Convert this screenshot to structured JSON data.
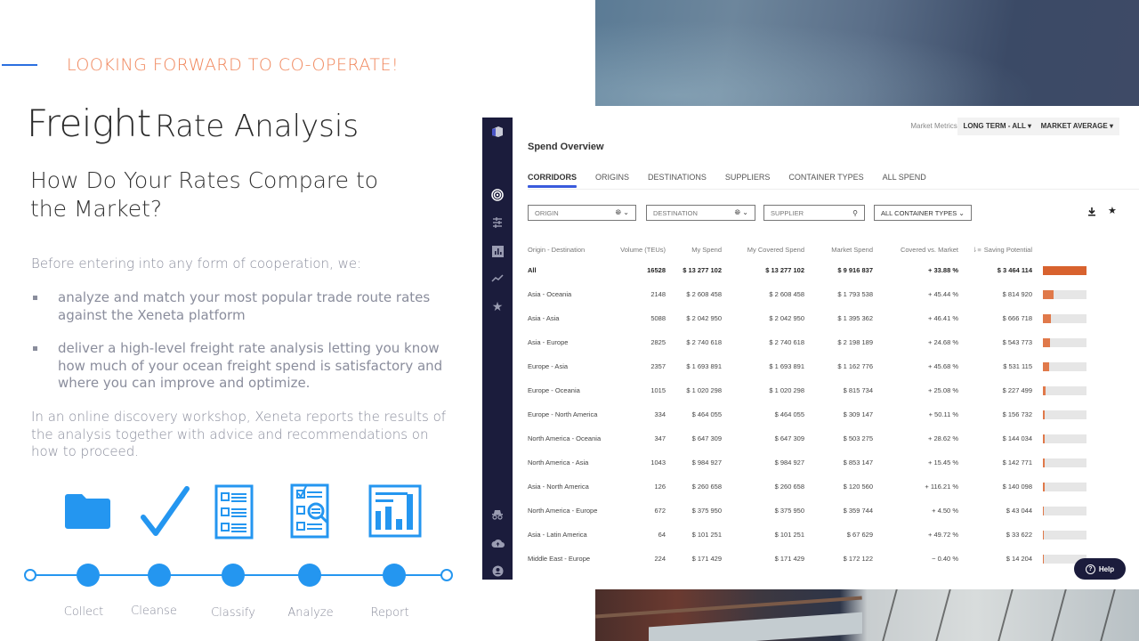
{
  "slide": {
    "tagline": "LOOKING FORWARD TO CO-OPERATE!",
    "title_big": "Freight",
    "title_small": "Rate Analysis",
    "subtitle": "How Do Your Rates Compare to the Market?",
    "intro": "Before entering into any form of cooperation, we:",
    "bullets": [
      "analyze and match your most popular trade route rates against the Xeneta platform",
      "deliver a high-level freight rate analysis letting you know how much of your ocean freight spend is satisfactory and where you can improve and optimize."
    ],
    "closing": "In an online discovery workshop, Xeneta reports the results of the analysis together with advice and recommendations on how to proceed.",
    "steps": [
      {
        "label": "Collect",
        "icon": "folder-icon"
      },
      {
        "label": "Cleanse",
        "icon": "checkmark-icon"
      },
      {
        "label": "Classify",
        "icon": "checklist-document-icon"
      },
      {
        "label": "Analyze",
        "icon": "document-magnifier-icon"
      },
      {
        "label": "Report",
        "icon": "bar-report-icon"
      }
    ],
    "accent_color": "#2496f0",
    "tagline_color": "#f0855a"
  },
  "app": {
    "nav_icons": [
      "logo-icon",
      "target-icon",
      "filters-icon",
      "bar-chart-icon",
      "trend-icon",
      "star-icon",
      "incognito-icon",
      "cloud-upload-icon",
      "account-icon"
    ],
    "market_metrics_label": "Market Metrics:",
    "market_metrics": [
      "LONG TERM - ALL",
      "MARKET AVERAGE"
    ],
    "page_title": "Spend Overview",
    "tabs": [
      "CORRIDORS",
      "ORIGINS",
      "DESTINATIONS",
      "SUPPLIERS",
      "CONTAINER TYPES",
      "ALL SPEND"
    ],
    "active_tab": "CORRIDORS",
    "filters": {
      "origin_placeholder": "ORIGIN",
      "destination_placeholder": "DESTINATION",
      "supplier_placeholder": "SUPPLIER",
      "container_types": "ALL CONTAINER TYPES"
    },
    "columns": [
      "Origin - Destination",
      "Volume (TEUs)",
      "My Spend",
      "My Covered Spend",
      "Market Spend",
      "Covered vs. Market",
      "Saving Potential"
    ],
    "rows": [
      {
        "route": "All",
        "volume": "16528",
        "my_spend": "$ 13 277 102",
        "covered": "$ 13 277 102",
        "market": "$ 9 916 837",
        "vs_market": "+ 33.88 %",
        "saving": "$ 3 464 114",
        "saving_share": 1.0
      },
      {
        "route": "Asia - Oceania",
        "volume": "2148",
        "my_spend": "$ 2 608 458",
        "covered": "$ 2 608 458",
        "market": "$ 1 793 538",
        "vs_market": "+ 45.44 %",
        "saving": "$ 814 920",
        "saving_share": 0.235
      },
      {
        "route": "Asia - Asia",
        "volume": "5088",
        "my_spend": "$ 2 042 950",
        "covered": "$ 2 042 950",
        "market": "$ 1 395 362",
        "vs_market": "+ 46.41 %",
        "saving": "$ 666 718",
        "saving_share": 0.192
      },
      {
        "route": "Asia - Europe",
        "volume": "2825",
        "my_spend": "$ 2 740 618",
        "covered": "$ 2 740 618",
        "market": "$ 2 198 189",
        "vs_market": "+ 24.68 %",
        "saving": "$ 543 773",
        "saving_share": 0.157
      },
      {
        "route": "Europe - Asia",
        "volume": "2357",
        "my_spend": "$ 1 693 891",
        "covered": "$ 1 693 891",
        "market": "$ 1 162 776",
        "vs_market": "+ 45.68 %",
        "saving": "$ 531 115",
        "saving_share": 0.153
      },
      {
        "route": "Europe - Oceania",
        "volume": "1015",
        "my_spend": "$ 1 020 298",
        "covered": "$ 1 020 298",
        "market": "$ 815 734",
        "vs_market": "+ 25.08 %",
        "saving": "$ 227 499",
        "saving_share": 0.066
      },
      {
        "route": "Europe - North America",
        "volume": "334",
        "my_spend": "$ 464 055",
        "covered": "$ 464 055",
        "market": "$ 309 147",
        "vs_market": "+ 50.11 %",
        "saving": "$ 156 732",
        "saving_share": 0.045
      },
      {
        "route": "North America - Oceania",
        "volume": "347",
        "my_spend": "$ 647 309",
        "covered": "$ 647 309",
        "market": "$ 503 275",
        "vs_market": "+ 28.62 %",
        "saving": "$ 144 034",
        "saving_share": 0.042
      },
      {
        "route": "North America - Asia",
        "volume": "1043",
        "my_spend": "$ 984 927",
        "covered": "$ 984 927",
        "market": "$ 853 147",
        "vs_market": "+ 15.45 %",
        "saving": "$ 142 771",
        "saving_share": 0.041
      },
      {
        "route": "Asia - North America",
        "volume": "126",
        "my_spend": "$ 260 658",
        "covered": "$ 260 658",
        "market": "$ 120 560",
        "vs_market": "+ 116.21 %",
        "saving": "$ 140 098",
        "saving_share": 0.04
      },
      {
        "route": "North America - Europe",
        "volume": "672",
        "my_spend": "$ 375 950",
        "covered": "$ 375 950",
        "market": "$ 359 744",
        "vs_market": "+ 4.50 %",
        "saving": "$ 43 044",
        "saving_share": 0.012
      },
      {
        "route": "Asia - Latin America",
        "volume": "64",
        "my_spend": "$ 101 251",
        "covered": "$ 101 251",
        "market": "$ 67 629",
        "vs_market": "+ 49.72 %",
        "saving": "$ 33 622",
        "saving_share": 0.01
      },
      {
        "route": "Middle East - Europe",
        "volume": "224",
        "my_spend": "$ 171 429",
        "covered": "$ 171 429",
        "market": "$ 172 122",
        "vs_market": "− 0.40 %",
        "saving": "$ 14 204",
        "saving_share": 0.004
      }
    ],
    "help_label": "Help",
    "bar_color": "#e0794a",
    "nav_color": "#1b1c3c",
    "tab_accent": "#3a5bdc"
  }
}
